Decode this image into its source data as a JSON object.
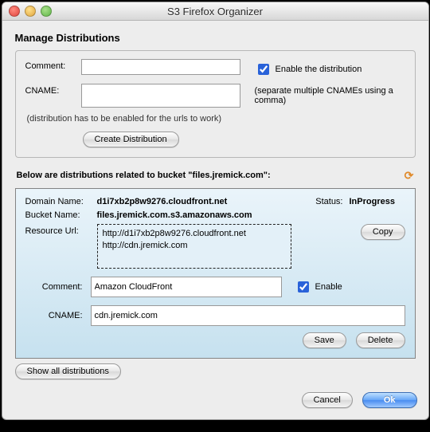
{
  "window": {
    "title": "S3 Firefox Organizer"
  },
  "header": {
    "manage": "Manage Distributions"
  },
  "form": {
    "comment_label": "Comment:",
    "comment_value": "",
    "cname_label": "CNAME:",
    "cname_value": "",
    "enable_label": "Enable the distribution",
    "cname_hint": "(separate multiple CNAMEs using a comma)",
    "enabled_hint": "(distribution has to be enabled for the urls to work)",
    "create_btn": "Create Distribution"
  },
  "list": {
    "header": "Below are distributions related to bucket \"files.jremick.com\":"
  },
  "dist": {
    "domain_label": "Domain Name:",
    "domain": "d1i7xb2p8w9276.cloudfront.net",
    "bucket_label": "Bucket Name:",
    "bucket": "files.jremick.com.s3.amazonaws.com",
    "status_label": "Status:",
    "status": "InProgress",
    "res_label": "Resource Url:",
    "res1": "http://d1i7xb2p8w9276.cloudfront.net",
    "res2": "http://cdn.jremick.com",
    "copy": "Copy",
    "comment_label": "Comment:",
    "comment": "Amazon CloudFront",
    "enable_label": "Enable",
    "cname_label": "CNAME:",
    "cname": "cdn.jremick.com",
    "save": "Save",
    "delete": "Delete"
  },
  "footer": {
    "show_all": "Show all distributions",
    "cancel": "Cancel",
    "ok": "Ok"
  }
}
